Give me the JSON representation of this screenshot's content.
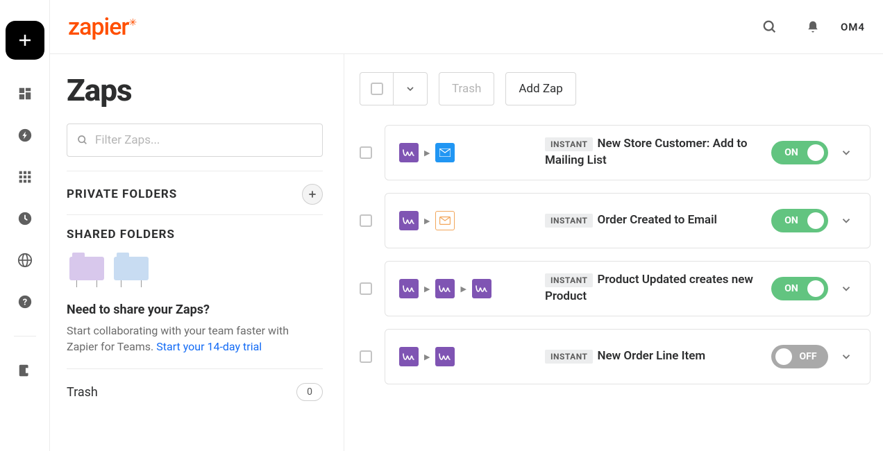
{
  "header": {
    "avatar": "OM4"
  },
  "page": {
    "title": "Zaps"
  },
  "filter": {
    "placeholder": "Filter Zaps..."
  },
  "sidebar": {
    "private_label": "PRIVATE FOLDERS",
    "shared_label": "SHARED FOLDERS",
    "share_heading": "Need to share your Zaps?",
    "share_text": "Start collaborating with your team faster with Zapier for Teams. ",
    "share_link": "Start your 14-day trial",
    "trash_label": "Trash",
    "trash_count": "0"
  },
  "toolbar": {
    "trash": "Trash",
    "add": "Add Zap"
  },
  "badge": {
    "instant": "INSTANT"
  },
  "status": {
    "on": "ON",
    "off": "OFF"
  },
  "zaps": [
    {
      "name": "New Store Customer: Add to Mailing List",
      "on": true,
      "apps": [
        "woo",
        "mail-blue"
      ]
    },
    {
      "name": "Order Created to Email",
      "on": true,
      "apps": [
        "woo",
        "mail-orange"
      ]
    },
    {
      "name": "Product Updated creates new Product",
      "on": true,
      "apps": [
        "woo",
        "woo",
        "woo"
      ]
    },
    {
      "name": "New Order Line Item",
      "on": false,
      "apps": [
        "woo",
        "woo"
      ]
    }
  ]
}
